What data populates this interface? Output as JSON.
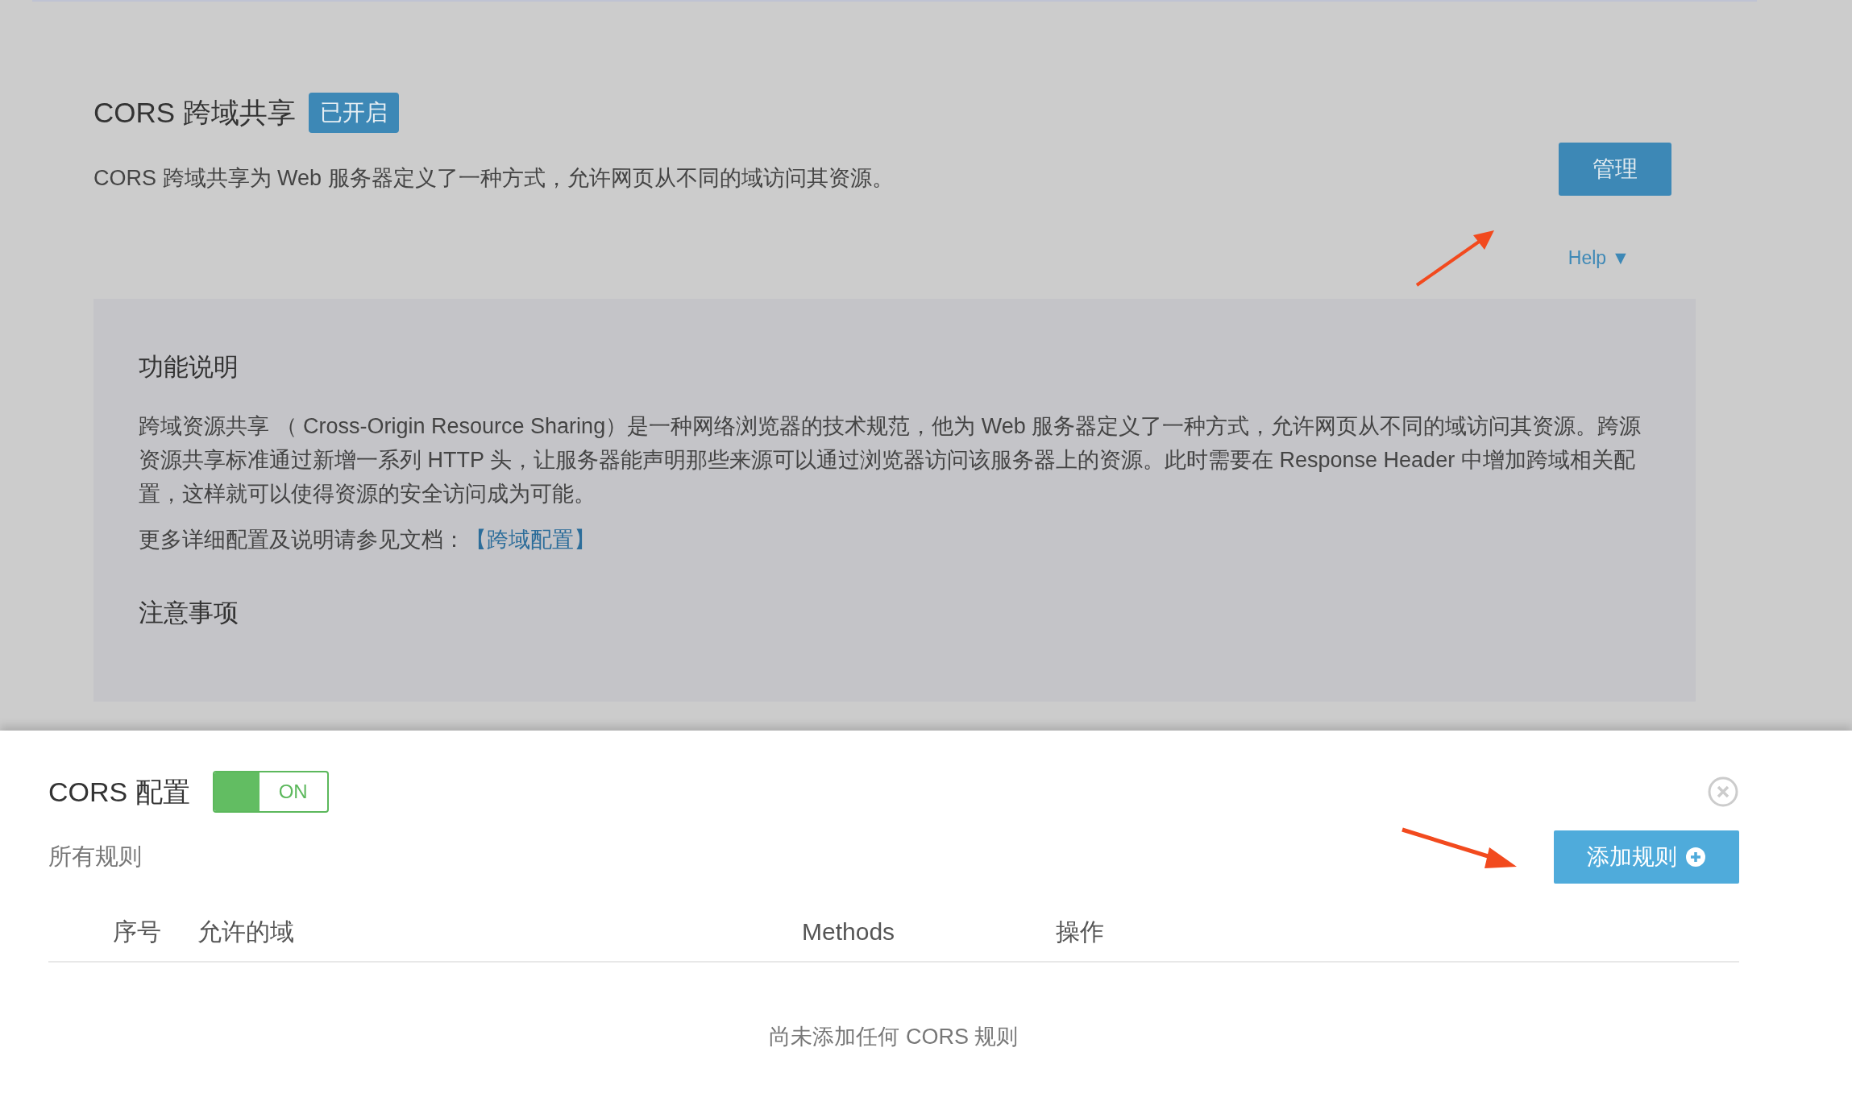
{
  "overview": {
    "title": "CORS 跨域共享",
    "status_badge": "已开启",
    "description": "CORS 跨域共享为 Web 服务器定义了一种方式，允许网页从不同的域访问其资源。",
    "manage_button": "管理",
    "help_link": "Help ▼"
  },
  "help_panel": {
    "sections": [
      {
        "heading": "功能说明",
        "paragraph": "跨域资源共享 （ Cross-Origin Resource Sharing）是一种网络浏览器的技术规范，他为 Web 服务器定义了一种方式，允许网页从不同的域访问其资源。跨源资源共享标准通过新增一系列 HTTP 头，让服务器能声明那些来源可以通过浏览器访问该服务器上的资源。此时需要在 Response Header 中增加跨域相关配置，这样就可以使得资源的安全访问成为可能。",
        "more_text": "更多详细配置及说明请参见文档：",
        "more_link": "【跨域配置】"
      },
      {
        "heading": "注意事项"
      }
    ]
  },
  "config_sheet": {
    "title": "CORS 配置",
    "toggle": {
      "label": "ON",
      "on": true
    },
    "rules_label": "所有规则",
    "add_button": "添加规则",
    "table": {
      "columns": [
        "序号",
        "允许的域",
        "Methods",
        "操作"
      ],
      "empty_text": "尚未添加任何 CORS 规则"
    }
  }
}
